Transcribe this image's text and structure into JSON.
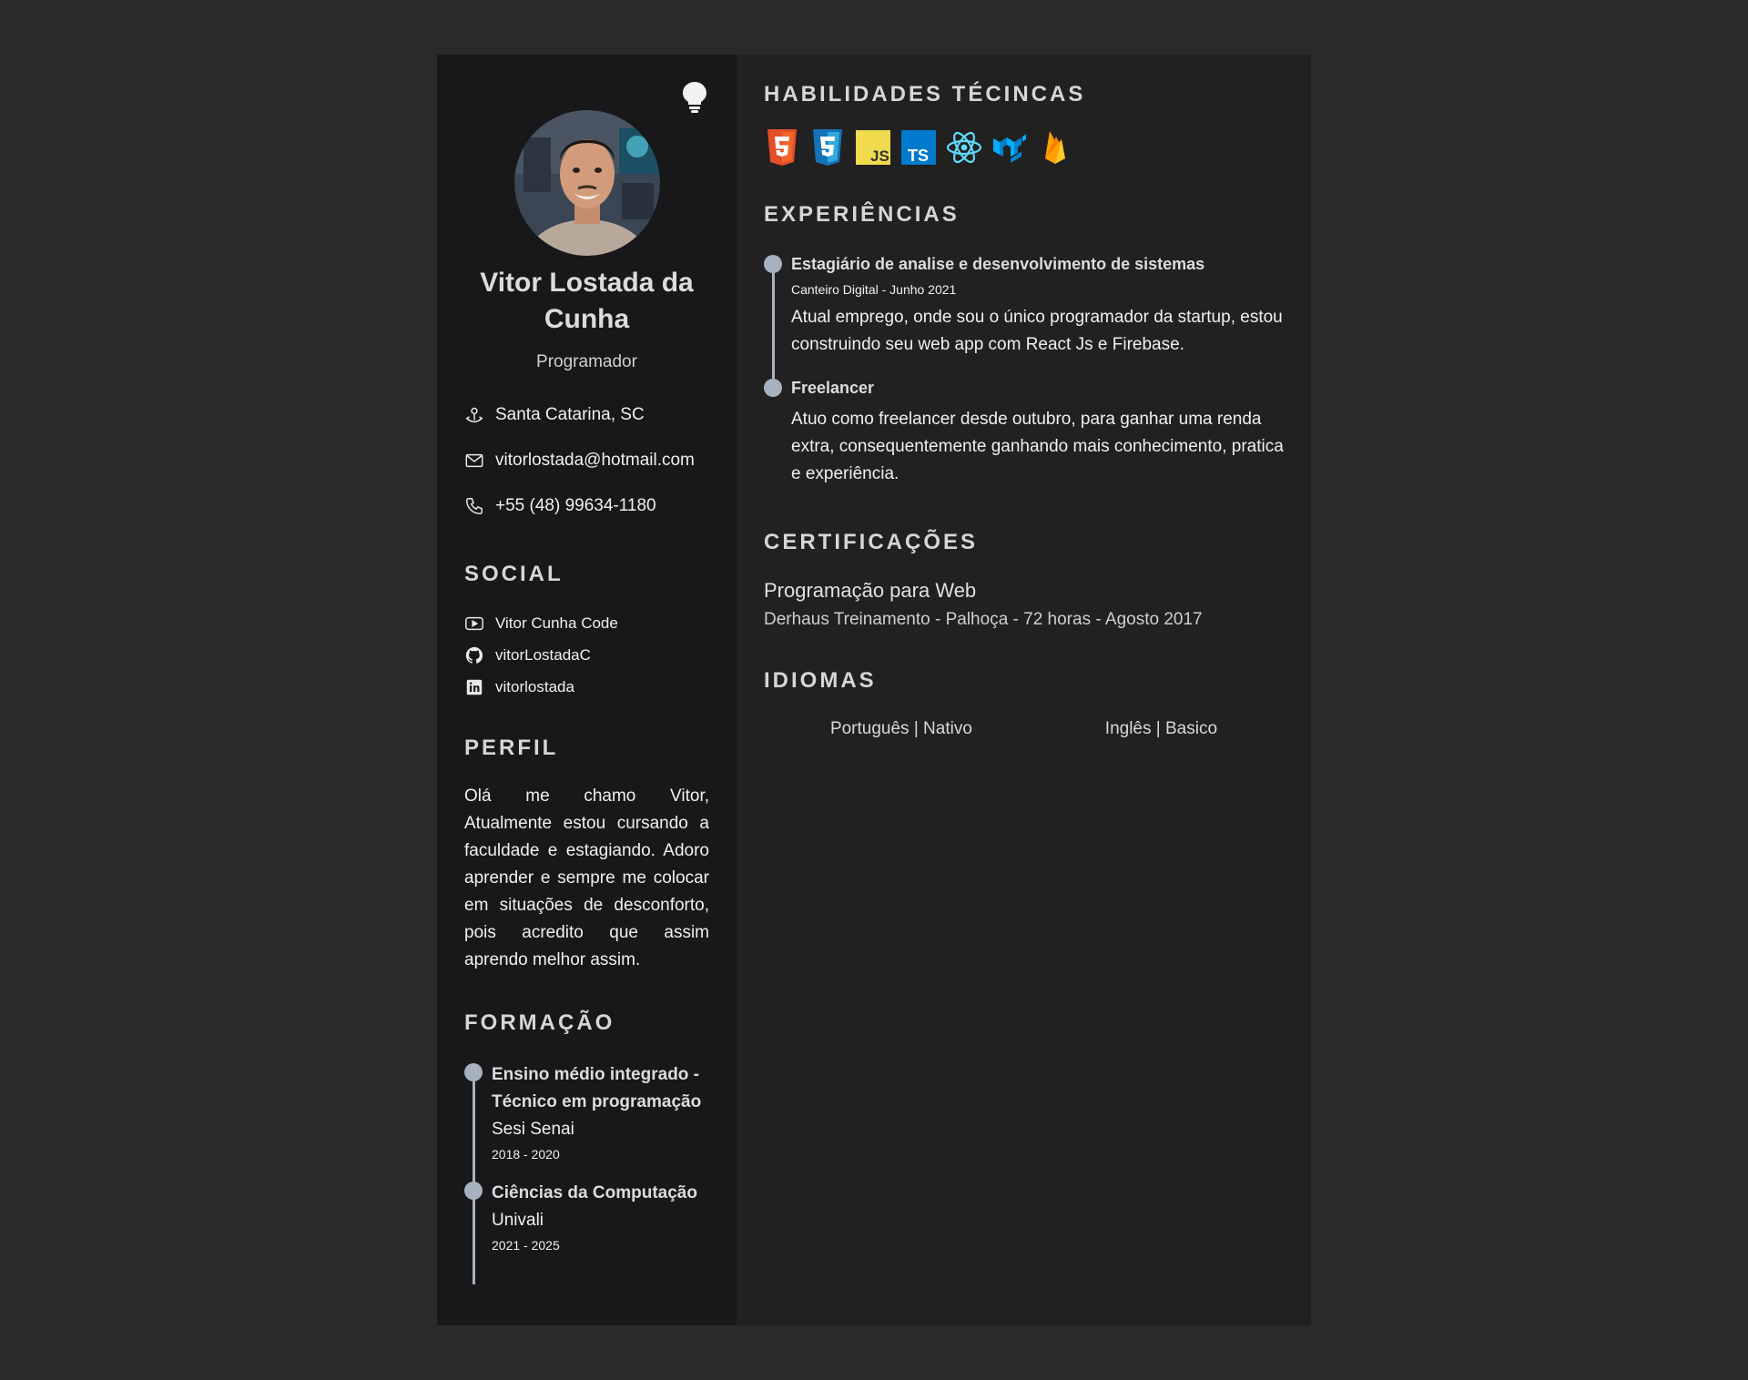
{
  "profile": {
    "name": "Vitor Lostada da Cunha",
    "role": "Programador",
    "location": "Santa Catarina, SC",
    "email": "vitorlostada@hotmail.com",
    "phone": "+55 (48) 99634-1180"
  },
  "social": {
    "title": "SOCIAL",
    "items": [
      {
        "label": "Vitor Cunha Code",
        "icon": "youtube-icon"
      },
      {
        "label": "vitorLostadaC",
        "icon": "github-icon"
      },
      {
        "label": "vitorlostada",
        "icon": "linkedin-icon"
      }
    ]
  },
  "perfil": {
    "title": "PERFIL",
    "text": "Olá me chamo Vitor, Atualmente estou cursando a faculdade e estagiando. Adoro aprender e sempre me colocar em situações de desconforto, pois acredito que assim aprendo melhor assim."
  },
  "formacao": {
    "title": "FORMAÇÃO",
    "items": [
      {
        "title": "Ensino médio integrado - Técnico em programação",
        "school": "Sesi Senai",
        "years": "2018 - 2020"
      },
      {
        "title": "Ciências da Computação",
        "school": "Univali",
        "years": "2021 - 2025"
      }
    ]
  },
  "skills": {
    "title": "HABILIDADES TÉCINCAS",
    "icons": [
      "html5-icon",
      "css3-icon",
      "javascript-icon",
      "typescript-icon",
      "react-icon",
      "material-ui-icon",
      "firebase-icon"
    ]
  },
  "experiencias": {
    "title": "EXPERIÊNCIAS",
    "items": [
      {
        "title": "Estagiário de analise e desenvolvimento de sistemas",
        "meta": "Canteiro Digital - Junho 2021",
        "desc": "Atual emprego, onde sou o único programador da startup, estou construindo seu web app com React Js e Firebase."
      },
      {
        "title": "Freelancer",
        "meta": "",
        "desc": "Atuo como freelancer desde outubro, para ganhar uma renda extra, consequentemente ganhando mais conhecimento, pratica e experiência."
      }
    ]
  },
  "certificacoes": {
    "title": "CERTIFICAÇÕES",
    "name": "Programação para Web",
    "detail": "Derhaus Treinamento - Palhoça - 72 horas - Agosto 2017"
  },
  "idiomas": {
    "title": "IDIOMAS",
    "items": [
      "Português | Nativo",
      "Inglês | Basico"
    ]
  },
  "colors": {
    "page_bg": "#2a2a2a",
    "sidebar_bg": "#18181a",
    "main_bg": "#212121",
    "timeline": "#a6b2be"
  }
}
